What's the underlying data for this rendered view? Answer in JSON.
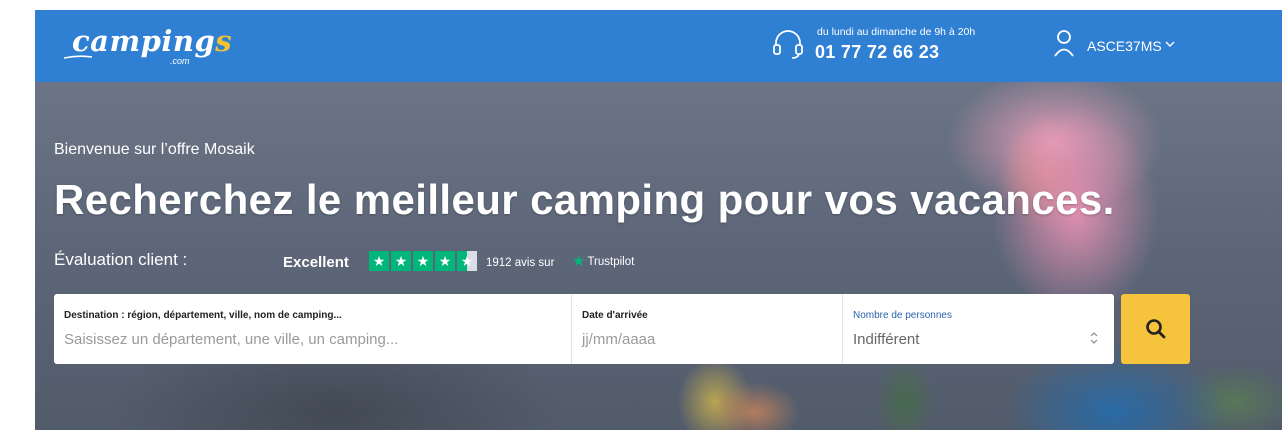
{
  "header": {
    "logo_text": "camping",
    "logo_accent": "s",
    "logo_sub": ".com",
    "phone_hours": "du lundi au dimanche de 9h à 20h",
    "phone_number": "01 77 72 66 23",
    "username": "ASCE37MS",
    "icons": [
      "headset-icon",
      "user-icon",
      "chevron-down-icon"
    ]
  },
  "hero": {
    "welcome": "Bienvenue sur l’offre Mosaik",
    "headline": "Recherchez le meilleur camping pour vos vacances."
  },
  "rating": {
    "label": "Évaluation client :",
    "score_text": "Excellent",
    "stars": 4.5,
    "reviews_text": "1912 avis sur",
    "provider": "Trustpilot"
  },
  "search": {
    "destination_label": "Destination : région, département, ville, nom de camping...",
    "destination_placeholder": "Saisissez un département, une ville, un camping...",
    "date_label": "Date d'arrivée",
    "date_placeholder": "jj/mm/aaaa",
    "persons_label": "Nombre de personnes",
    "persons_value": "Indifférent",
    "submit_icon": "search-icon"
  },
  "colors": {
    "topbar": "#2f7fd3",
    "logo_accent": "#f2c233",
    "search_button": "#f6c33d",
    "trustpilot_green": "#00b67a"
  }
}
